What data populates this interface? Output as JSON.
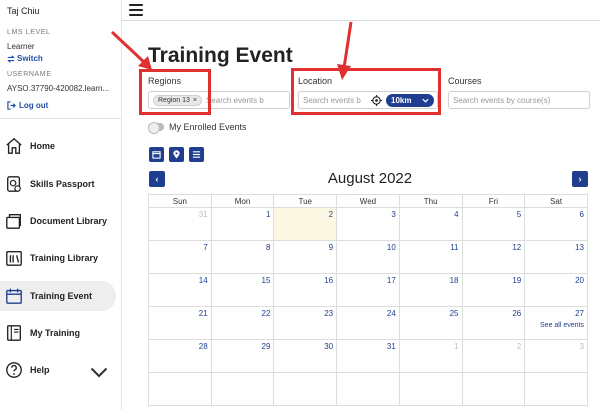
{
  "sidebar": {
    "user_name": "Taj Chiu",
    "lms_label": "LMS LEVEL",
    "lms_value": "Learner",
    "switch_label": "Switch",
    "username_label": "USERNAME",
    "username_value": "AYSO.37790-420082.learn...",
    "logout_label": "Log out",
    "nav": [
      {
        "label": "Home",
        "icon": "home-icon"
      },
      {
        "label": "Skills Passport",
        "icon": "passport-icon"
      },
      {
        "label": "Document Library",
        "icon": "document-library-icon"
      },
      {
        "label": "Training Library",
        "icon": "training-library-icon"
      },
      {
        "label": "Training Event",
        "icon": "calendar-icon",
        "active": true
      },
      {
        "label": "My Training",
        "icon": "book-icon"
      },
      {
        "label": "Help",
        "icon": "help-icon"
      }
    ]
  },
  "main": {
    "title": "Training Event",
    "regions_label": "Regions",
    "region_chip": "Region 13",
    "region_placeholder": "Search events b",
    "location_label": "Location",
    "location_placeholder": "Search events b",
    "radius": "10km",
    "courses_label": "Courses",
    "courses_placeholder": "Search events by course(s)",
    "enrolled_toggle_label": "My Enrolled Events"
  },
  "calendar": {
    "month": "August 2022",
    "weekdays": [
      "Sun",
      "Mon",
      "Tue",
      "Wed",
      "Thu",
      "Fri",
      "Sat"
    ],
    "weeks": [
      [
        "31",
        "1",
        "2",
        "3",
        "4",
        "5",
        "6"
      ],
      [
        "7",
        "8",
        "9",
        "10",
        "11",
        "12",
        "13"
      ],
      [
        "14",
        "15",
        "16",
        "17",
        "18",
        "19",
        "20"
      ],
      [
        "21",
        "22",
        "23",
        "24",
        "25",
        "26",
        "27"
      ],
      [
        "28",
        "29",
        "30",
        "31",
        "1",
        "2",
        "3"
      ],
      [
        "",
        "",
        "",
        "",
        "",
        "",
        ""
      ]
    ],
    "see_all": "See all events"
  },
  "colors": {
    "accent": "#1f3e8f",
    "highlight": "#e03030",
    "today": "#fcf8e3"
  }
}
